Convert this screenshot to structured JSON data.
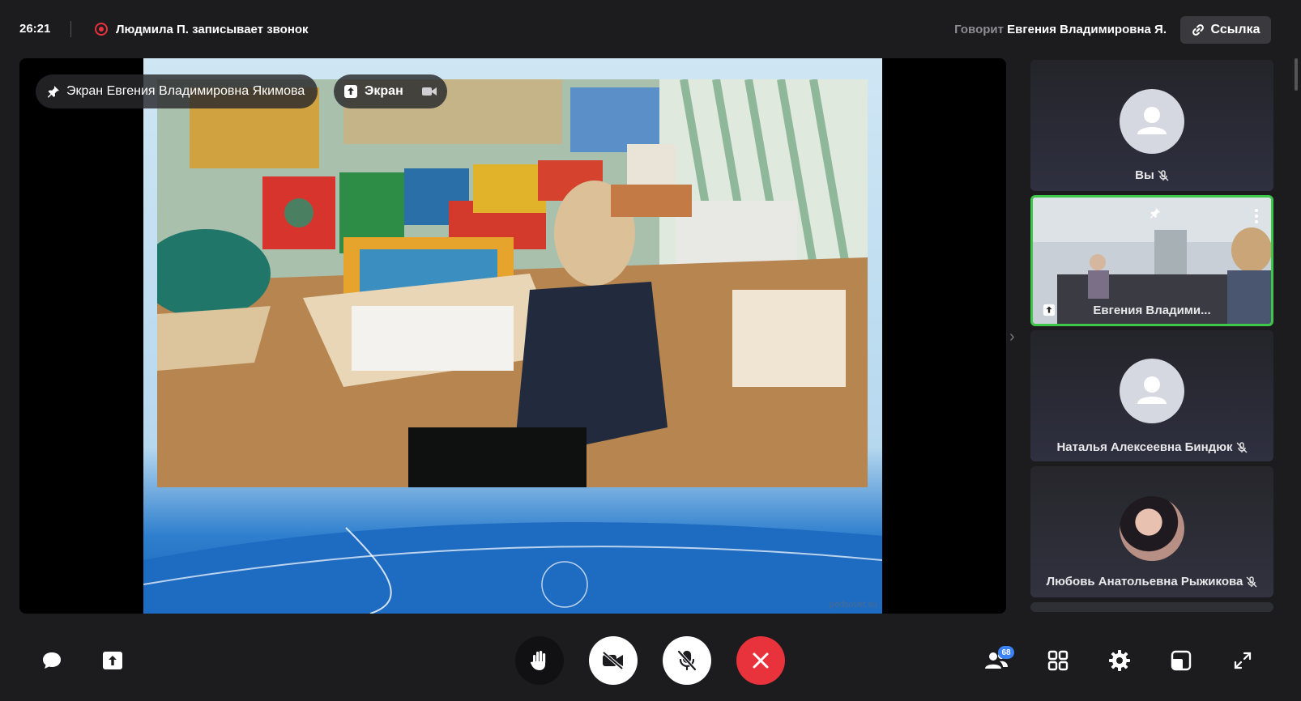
{
  "topbar": {
    "timer": "26:21",
    "recording_text": "Людмила П. записывает звонок",
    "speaker_label": "Говорит",
    "speaker_name": "Евгения Владимировна Я.",
    "link_label": "Ссылка"
  },
  "stage": {
    "pin_label": "Экран Евгения Владимировна Якимова",
    "screen_label": "Экран",
    "watermark": "pedsovet.su"
  },
  "participants": [
    {
      "name": "Вы",
      "muted": true
    },
    {
      "name": "Евгения Владими...",
      "muted": false,
      "active": true
    },
    {
      "name": "Наталья Алексеевна Биндюк",
      "muted": true
    },
    {
      "name": "Любовь Анатольевна Рыжикова",
      "muted": true
    }
  ],
  "bottombar": {
    "participants_count": "68"
  },
  "colors": {
    "record": "#e8323c",
    "hangup": "#e8323c",
    "active_border": "#3ec84a",
    "badge": "#3b82f6"
  },
  "icons": [
    "record-icon",
    "link-icon",
    "pin-icon",
    "screen-share-icon",
    "camera-icon",
    "chat-icon",
    "share-icon",
    "raise-hand-icon",
    "video-off-icon",
    "mic-off-icon",
    "hangup-icon",
    "participants-icon",
    "grid-icon",
    "settings-icon",
    "layout-icon",
    "fullscreen-icon",
    "chevron-right-icon"
  ]
}
